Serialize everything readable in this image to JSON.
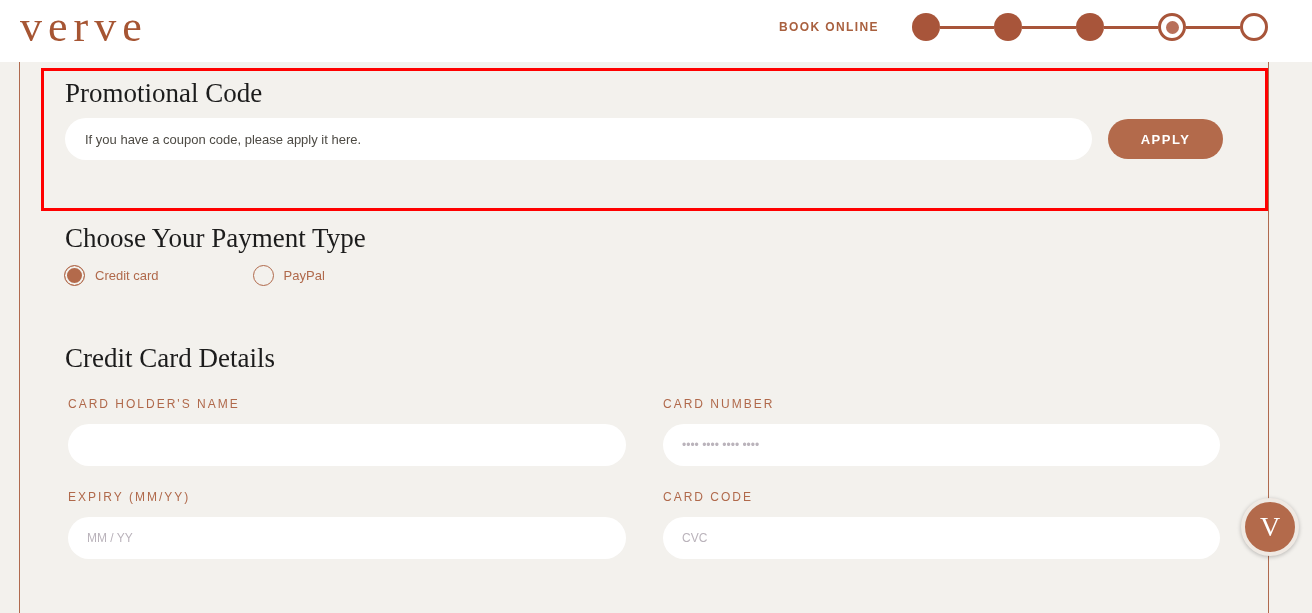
{
  "header": {
    "logo": "verve",
    "book_online": "BOOK ONLINE",
    "steps": [
      {
        "completed": true,
        "current": false
      },
      {
        "completed": true,
        "current": false
      },
      {
        "completed": true,
        "current": false
      },
      {
        "completed": false,
        "current": true
      },
      {
        "completed": false,
        "current": false
      }
    ]
  },
  "promo": {
    "highlighted": true,
    "title": "Promotional Code",
    "field": {
      "placeholder": "If you have a coupon code, please apply it here."
    },
    "button": "APPLY"
  },
  "payment": {
    "title": "Choose Your Payment Type",
    "options": [
      {
        "label": "Credit card",
        "selected": true
      },
      {
        "label": "PayPal",
        "selected": false
      }
    ]
  },
  "card_details": {
    "title": "Credit Card Details",
    "fields": [
      {
        "label": "CARD HOLDER'S NAME"
      },
      {
        "label": "CARD NUMBER",
        "placeholder": "•••• •••• •••• ••••"
      },
      {
        "label": "EXPIRY (MM/YY)",
        "placeholder": "MM / YY"
      },
      {
        "label": "CARD CODE",
        "placeholder": "CVC"
      }
    ]
  },
  "floating_button": {
    "label": "V"
  }
}
